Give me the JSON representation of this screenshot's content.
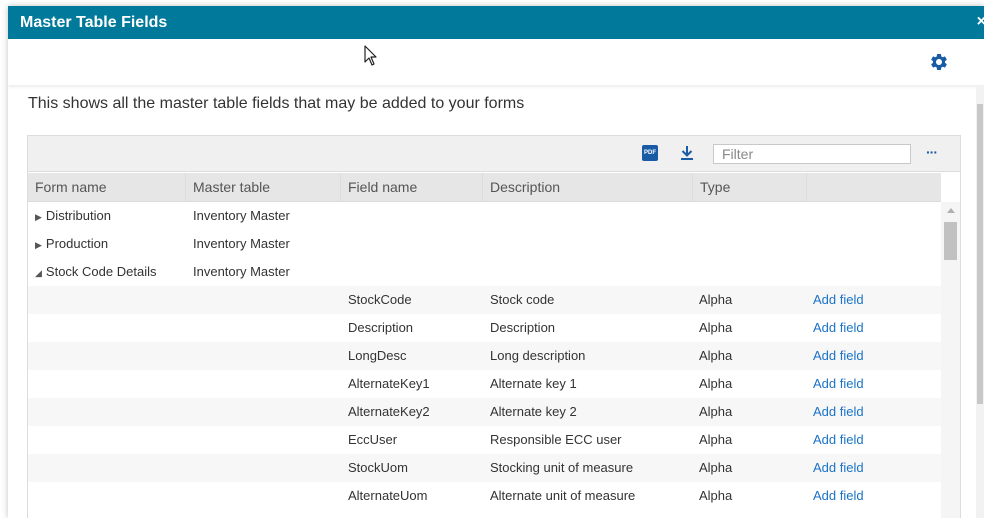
{
  "dialog": {
    "title": "Master Table Fields",
    "close_label": "×",
    "settings_icon": "gear-icon",
    "intro": "This shows all the master table fields that may be added to your forms"
  },
  "grid_toolbar": {
    "pdf_label": "PDF",
    "pdf_icon": "pdf-export-icon",
    "download_icon": "download-icon",
    "filter_placeholder": "Filter",
    "more_label": "···"
  },
  "columns": [
    "Form name",
    "Master table",
    "Field name",
    "Description",
    "Type"
  ],
  "groups": [
    {
      "form_name": "Distribution",
      "master_table": "Inventory Master",
      "expanded": false
    },
    {
      "form_name": "Production",
      "master_table": "Inventory Master",
      "expanded": false
    },
    {
      "form_name": "Stock Code Details",
      "master_table": "Inventory Master",
      "expanded": true
    }
  ],
  "fields": [
    {
      "field_name": "StockCode",
      "description": "Stock code",
      "type": "Alpha",
      "action": "Add field"
    },
    {
      "field_name": "Description",
      "description": "Description",
      "type": "Alpha",
      "action": "Add field"
    },
    {
      "field_name": "LongDesc",
      "description": "Long description",
      "type": "Alpha",
      "action": "Add field"
    },
    {
      "field_name": "AlternateKey1",
      "description": "Alternate key 1",
      "type": "Alpha",
      "action": "Add field"
    },
    {
      "field_name": "AlternateKey2",
      "description": "Alternate key 2",
      "type": "Alpha",
      "action": "Add field"
    },
    {
      "field_name": "EccUser",
      "description": "Responsible ECC user",
      "type": "Alpha",
      "action": "Add field"
    },
    {
      "field_name": "StockUom",
      "description": "Stocking unit of measure",
      "type": "Alpha",
      "action": "Add field"
    },
    {
      "field_name": "AlternateUom",
      "description": "Alternate unit of measure",
      "type": "Alpha",
      "action": "Add field"
    }
  ],
  "colors": {
    "titlebar": "#00799a",
    "link": "#1a73c8",
    "icon_blue": "#1a5ba6"
  }
}
